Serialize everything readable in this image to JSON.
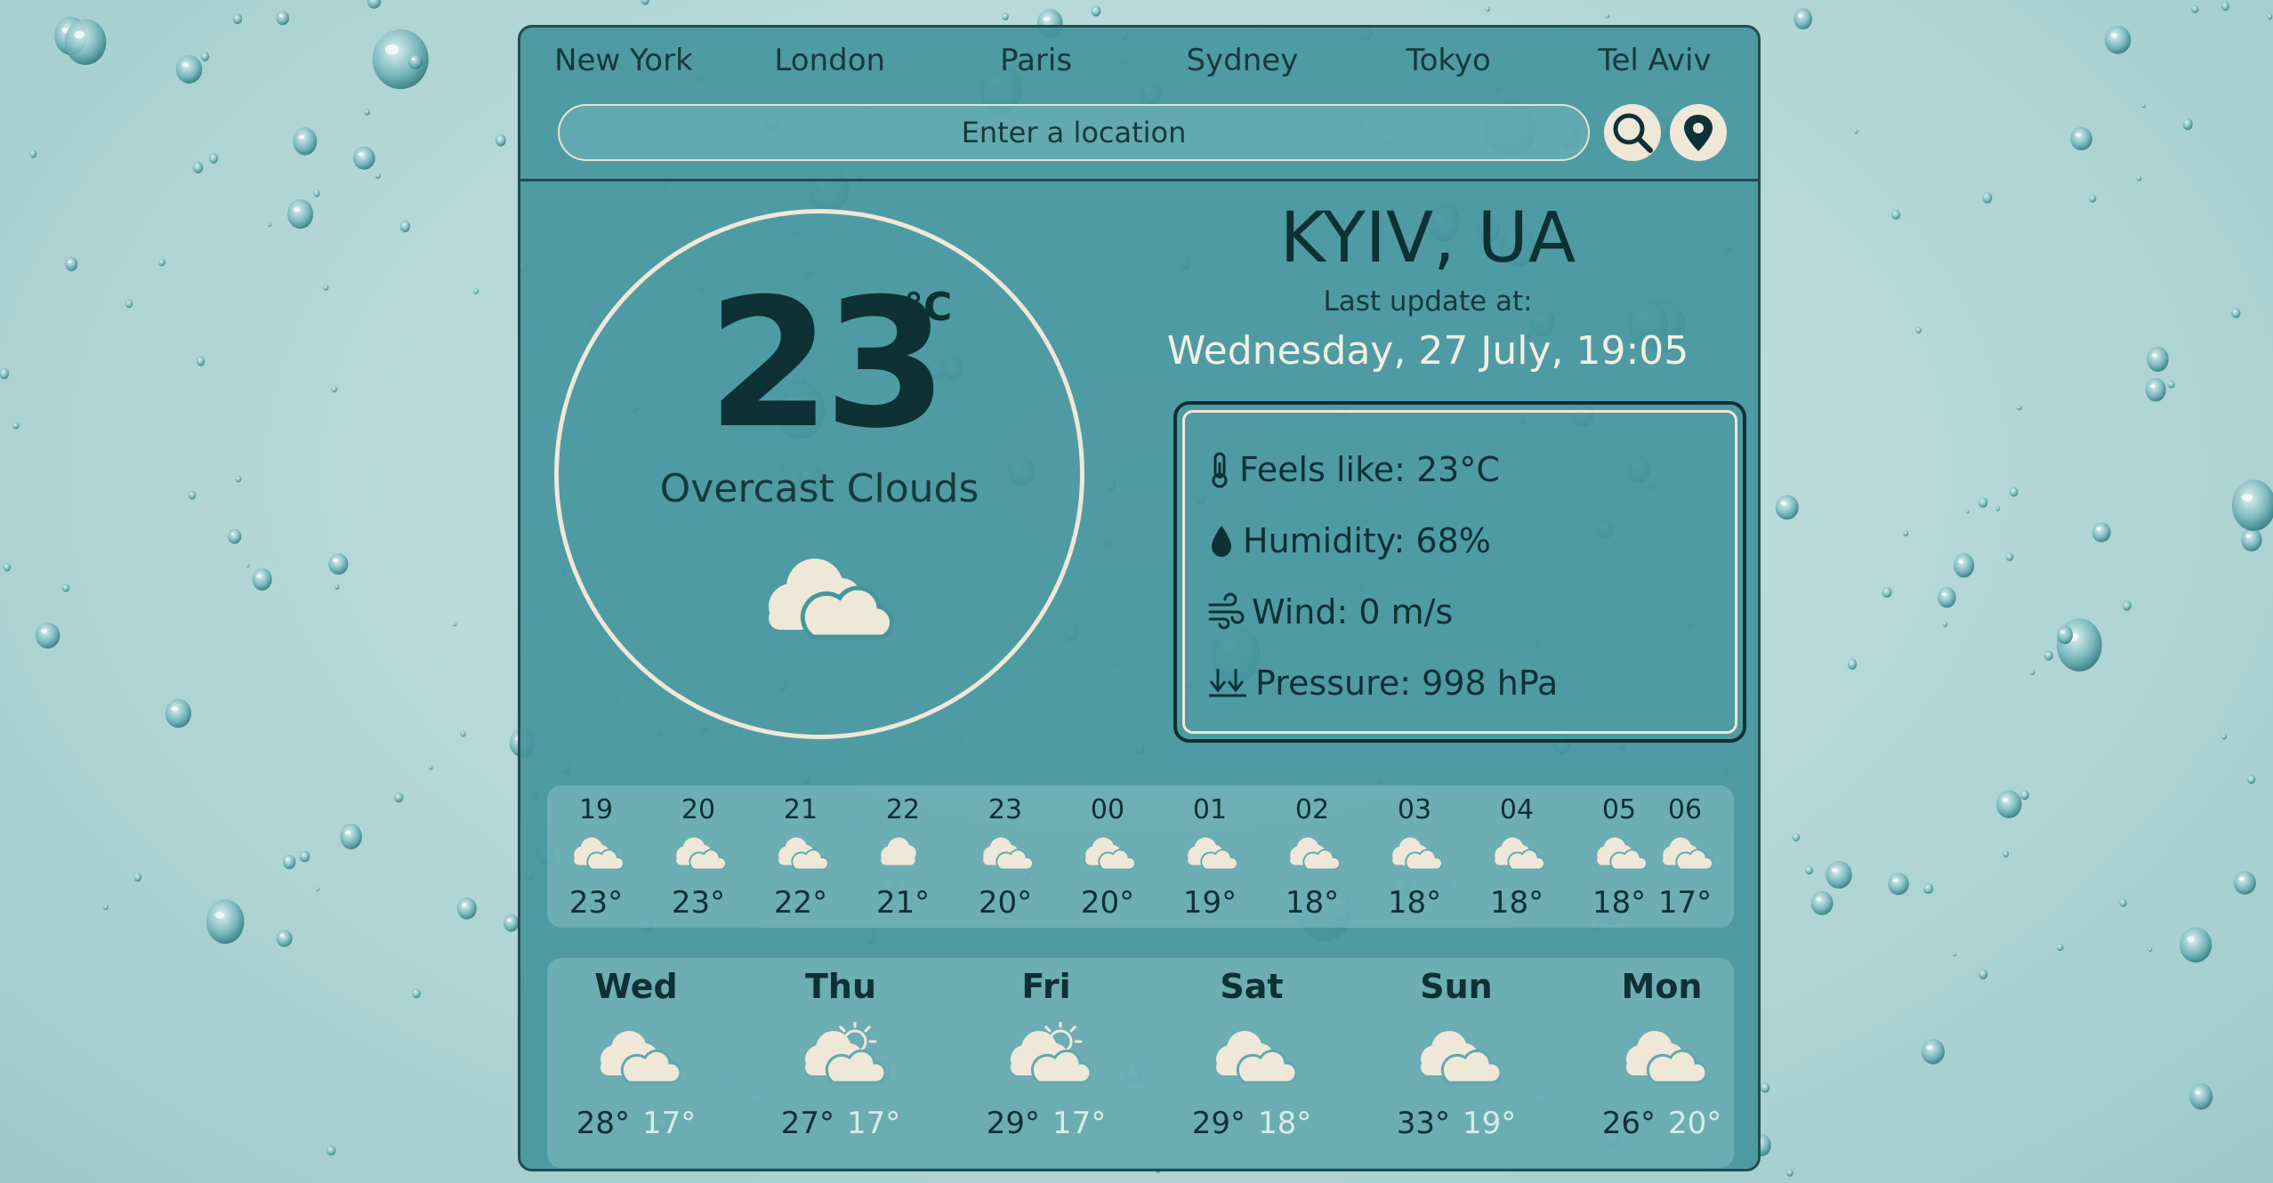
{
  "cities": [
    "New York",
    "London",
    "Paris",
    "Sydney",
    "Tokyo",
    "Tel Aviv"
  ],
  "search": {
    "placeholder": "Enter a location"
  },
  "current": {
    "temperature": "23",
    "unit": "°C",
    "condition": "Overcast Clouds",
    "icon": "overcast-clouds-icon"
  },
  "location": {
    "name": "KYIV, UA",
    "update_label": "Last update at:",
    "update_time": "Wednesday, 27 July, 19:05"
  },
  "details": {
    "feels_like": "Feels like: 23°C",
    "humidity": "Humidity: 68%",
    "wind": "Wind: 0 m/s",
    "pressure": "Pressure: 998 hPa"
  },
  "hourly": [
    {
      "hour": "19",
      "temp": "23°",
      "icon": "clouds-icon"
    },
    {
      "hour": "20",
      "temp": "23°",
      "icon": "clouds-icon"
    },
    {
      "hour": "21",
      "temp": "22°",
      "icon": "clouds-icon"
    },
    {
      "hour": "22",
      "temp": "21°",
      "icon": "cloud-icon"
    },
    {
      "hour": "23",
      "temp": "20°",
      "icon": "clouds-icon"
    },
    {
      "hour": "00",
      "temp": "20°",
      "icon": "clouds-icon"
    },
    {
      "hour": "01",
      "temp": "19°",
      "icon": "clouds-icon"
    },
    {
      "hour": "02",
      "temp": "18°",
      "icon": "clouds-icon"
    },
    {
      "hour": "03",
      "temp": "18°",
      "icon": "clouds-icon"
    },
    {
      "hour": "04",
      "temp": "18°",
      "icon": "clouds-icon"
    },
    {
      "hour": "05",
      "temp": "18°",
      "icon": "clouds-icon"
    },
    {
      "hour": "06",
      "temp": "17°",
      "icon": "clouds-icon"
    }
  ],
  "daily": [
    {
      "day": "Wed",
      "high": "28°",
      "low": "17°",
      "icon": "clouds-icon"
    },
    {
      "day": "Thu",
      "high": "27°",
      "low": "17°",
      "icon": "sun-behind-cloud-icon"
    },
    {
      "day": "Fri",
      "high": "29°",
      "low": "17°",
      "icon": "sun-behind-cloud-icon"
    },
    {
      "day": "Sat",
      "high": "29°",
      "low": "18°",
      "icon": "clouds-icon"
    },
    {
      "day": "Sun",
      "high": "33°",
      "low": "19°",
      "icon": "clouds-icon"
    },
    {
      "day": "Mon",
      "high": "26°",
      "low": "20°",
      "icon": "clouds-icon"
    }
  ],
  "colors": {
    "card": "#46969e",
    "dark_text": "#0e3135",
    "cream": "#efe7d8"
  }
}
